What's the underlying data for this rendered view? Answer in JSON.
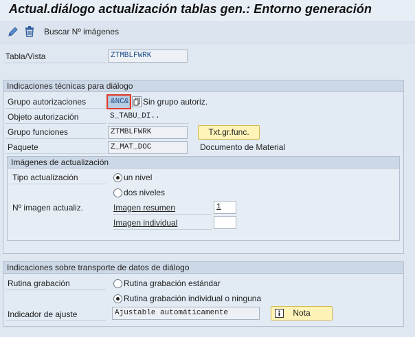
{
  "window": {
    "title": "Actual.diálogo actualización tablas gen.: Entorno generación"
  },
  "toolbar": {
    "edit_icon": "pencil-icon",
    "delete_icon": "trash-icon",
    "search_images_label": "Buscar Nº imágenes"
  },
  "table": {
    "label": "Tabla/Vista",
    "value": "ZTMBLFWRK"
  },
  "technical": {
    "header": "Indicaciones técnicas para diálogo",
    "auth_group": {
      "label": "Grupo autorizaciones",
      "value": "&NC&",
      "hint": "Sin grupo autoriz."
    },
    "auth_object": {
      "label": "Objeto autorización",
      "value": "S_TABU_DI.."
    },
    "function_group": {
      "label": "Grupo funciones",
      "value": "ZTMBLFWRK",
      "button": "Txt.gr.func."
    },
    "package": {
      "label": "Paquete",
      "value": "Z_MAT_DOC",
      "description": "Documento de Material"
    },
    "images": {
      "header": "Imágenes de actualización",
      "type_label": "Tipo actualización",
      "one_level": "un nivel",
      "two_levels": "dos niveles",
      "image_number_label": "Nº imagen actualiz.",
      "summary_label": "Imagen resumen",
      "summary_value": "1",
      "single_label": "Imagen individual",
      "single_value": ""
    }
  },
  "transport": {
    "header": "Indicaciones sobre transporte de datos de diálogo",
    "routine_label": "Rutina grabación",
    "routine_standard": "Rutina grabación estándar",
    "routine_individual": "Rutina grabación individual o ninguna",
    "adjust_label": "Indicador de ajuste",
    "adjust_value": "Ajustable automáticamente",
    "note_button": "Nota"
  },
  "colors": {
    "accent_button": "#fff3b8",
    "focus": "#e23b2c",
    "link_text": "#1d4f8c"
  }
}
